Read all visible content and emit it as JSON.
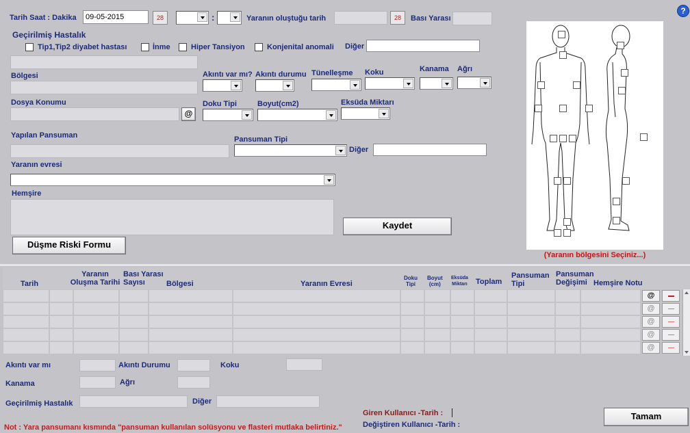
{
  "form": {
    "tarih_saat_label": "Tarih Saat : Dakika",
    "date_value": "09-05-2015",
    "time_separator": ":",
    "yara_tarih_label": "Yaranın oluştuğu tarih",
    "basi_yarasi_label": "Bası Yarası",
    "gecirilmis_label": "Geçirilmiş Hastalık",
    "checkboxes": [
      "Tip1,Tip2 diyabet hastası",
      "İnme",
      "Hiper Tansiyon",
      "Konjenital anomali"
    ],
    "diger_label": "Diğer",
    "bolgesi_label": "Bölgesi",
    "akinti_var_label": "Akıntı var mı?",
    "akinti_durumu_label": "Akıntı durumu",
    "tunellesme_label": "Tünelleşme",
    "koku_label": "Koku",
    "kanama_label": "Kanama",
    "agri_label": "Ağrı",
    "dosya_label": "Dosya Konumu",
    "at_symbol": "@",
    "doku_tipi_label": "Doku Tipi",
    "boyut_label": "Boyut(cm2)",
    "eksuda_label": "Eksüda Miktarı",
    "yapilan_pansuman_label": "Yapılan Pansuman",
    "pansuman_tipi_label": "Pansuman Tipi",
    "diger2_label": "Diğer",
    "yara_evresi_label": "Yaranın evresi",
    "hemsire_label": "Hemşire",
    "kaydet_button": "Kaydet",
    "dusme_button": "Düşme Riski Formu",
    "body_caption": "(Yaranın bölgesini Seçiniz...)",
    "help_icon_glyph": "?"
  },
  "table": {
    "headers": [
      "Tarih",
      "Yaranın Oluşma Tarihi",
      "Bası Yarası Sayısı",
      "Bölgesi",
      "Yaranın Evresi",
      "Doku Tipi",
      "Boyut (cm)",
      "Eksüda Miktarı",
      "Toplam",
      "Pansuman Tipi",
      "Pansuman Değişimi",
      "Hemşire Notu"
    ],
    "header_lines": {
      "yara_olusma_1": "Yaranın",
      "yara_olusma_2": "Oluşma Tarihi",
      "basi_1": "Bası Yarası",
      "basi_2": "Sayısı",
      "doku_1": "Doku",
      "doku_2": "Tipi",
      "boyut_1": "Boyut",
      "boyut_2": "(cm)",
      "eksuda_1": "Eksüda",
      "eksuda_2": "Miktarı",
      "pans_tipi_1": "Pansuman",
      "pans_tipi_2": "Tipi",
      "pans_deg_1": "Pansuman",
      "pans_deg_2": "Değişimi"
    },
    "row_count": 5
  },
  "summary": {
    "akinti_var_label": "Akıntı var mı",
    "akinti_durumu_label": "Akıntı Durumu",
    "koku_label": "Koku",
    "kanama_label": "Kanama",
    "agri_label": "Ağrı",
    "gecirilmis_label": "Geçirilmiş Hastalık",
    "diger_label": "Diğer"
  },
  "footer": {
    "note": "Not : Yara pansumanı kısmında \"pansuman kullanılan solüsyonu ve flasteri mutlaka belirtiniz.\"",
    "giren_label": "Giren Kullanıcı -Tarih  :",
    "degistiren_label": "Değiştiren Kullanıcı -Tarih  :",
    "tamam_button": "Tamam"
  },
  "colors": {
    "label": "#1c2a7a",
    "note_red": "#c81a1a",
    "caption_red": "#cc1111",
    "background": "#c4c4c8"
  }
}
